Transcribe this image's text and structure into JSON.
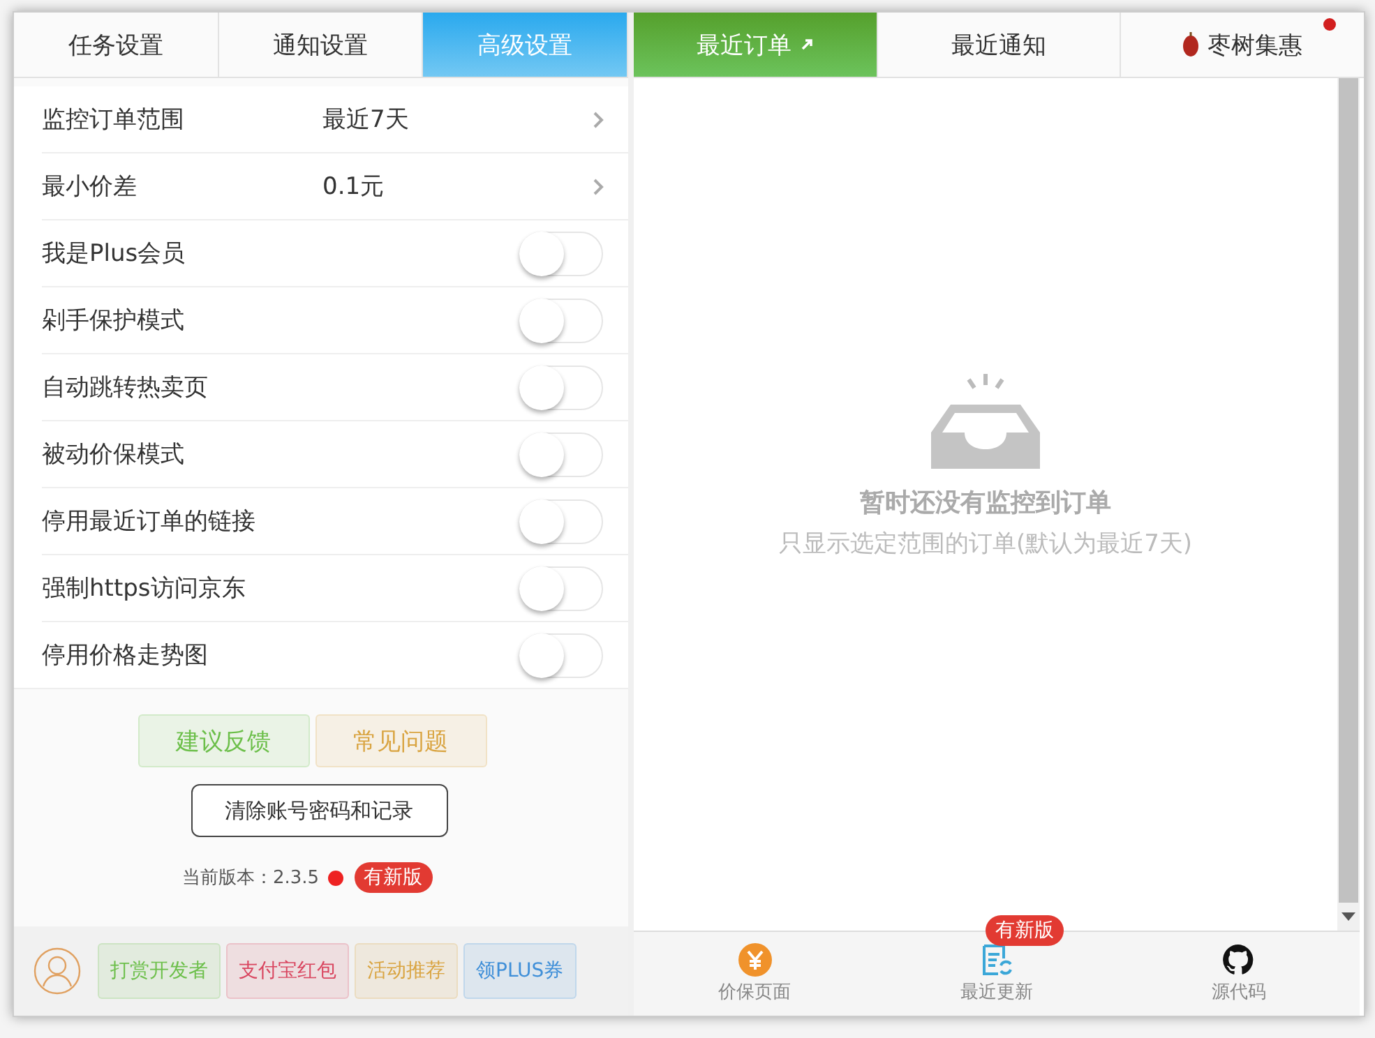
{
  "left_tabs": [
    {
      "label": "任务设置",
      "selected": false
    },
    {
      "label": "通知设置",
      "selected": false
    },
    {
      "label": "高级设置",
      "selected": true
    }
  ],
  "settings": [
    {
      "kind": "select",
      "label": "监控订单范围",
      "value": "最近7天"
    },
    {
      "kind": "select",
      "label": "最小价差",
      "value": "0.1元"
    },
    {
      "kind": "toggle",
      "label": "我是Plus会员",
      "on": false
    },
    {
      "kind": "toggle",
      "label": "剁手保护模式",
      "on": false
    },
    {
      "kind": "toggle",
      "label": "自动跳转热卖页",
      "on": false
    },
    {
      "kind": "toggle",
      "label": "被动价保模式",
      "on": false
    },
    {
      "kind": "toggle",
      "label": "停用最近订单的链接",
      "on": false
    },
    {
      "kind": "toggle",
      "label": "强制https访问京东",
      "on": false
    },
    {
      "kind": "toggle",
      "label": "停用价格走势图",
      "on": false
    }
  ],
  "action_buttons": [
    {
      "label": "建议反馈",
      "color": "#6cbf4a"
    },
    {
      "label": "常见问题",
      "color": "#d9a441"
    }
  ],
  "clear_button": "清除账号密码和记录",
  "version": {
    "label": "当前版本：2.3.5",
    "new_dot": true,
    "badge": "有新版"
  },
  "left_footer_buttons": [
    {
      "label": "打赏开发者",
      "color": "#6cbf4a"
    },
    {
      "label": "支付宝红包",
      "color": "#d9455f"
    },
    {
      "label": "活动推荐",
      "color": "#d9a441"
    },
    {
      "label": "领PLUS券",
      "color": "#3f8fd8"
    }
  ],
  "right_tabs": [
    {
      "label": "最近订单",
      "selected": true,
      "dot": false
    },
    {
      "label": "最近通知",
      "selected": false,
      "dot": false
    },
    {
      "label": "枣树集惠",
      "selected": false,
      "dot": true
    }
  ],
  "empty_state": {
    "title": "暂时还没有监控到订单",
    "subtitle": "只显示选定范围的订单(默认为最近7天)"
  },
  "right_footer": [
    {
      "label": "价保页面"
    },
    {
      "label": "最近更新",
      "badge": "有新版"
    },
    {
      "label": "源代码"
    }
  ]
}
